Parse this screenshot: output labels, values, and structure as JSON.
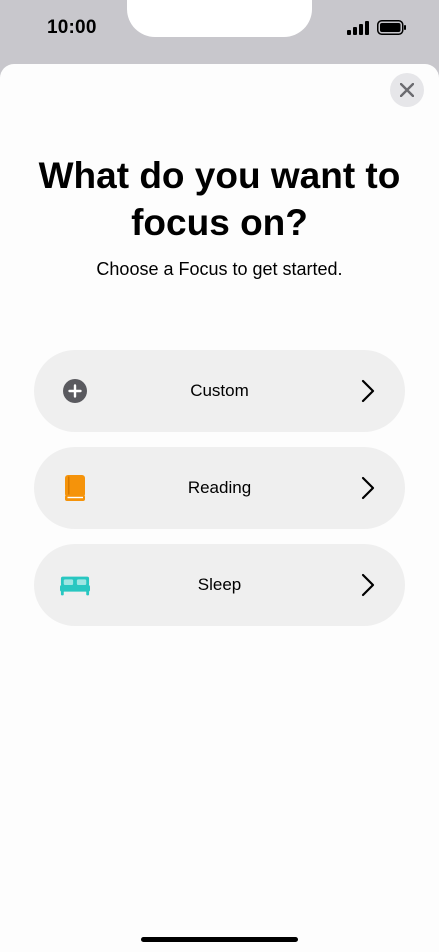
{
  "status_bar": {
    "time": "10:00"
  },
  "sheet": {
    "close_icon": "close-icon",
    "title": "What do you want to focus on?",
    "subtitle": "Choose a Focus to get started."
  },
  "options": [
    {
      "label": "Custom",
      "icon": "plus-circle-icon",
      "icon_color": "#5a5a5f"
    },
    {
      "label": "Reading",
      "icon": "book-icon",
      "icon_color": "#f5930a"
    },
    {
      "label": "Sleep",
      "icon": "bed-icon",
      "icon_color": "#28c7c1"
    }
  ],
  "colors": {
    "sheet_bg": "#fdfdfd",
    "option_bg": "#efefef",
    "backdrop": "#c8c7cc"
  }
}
